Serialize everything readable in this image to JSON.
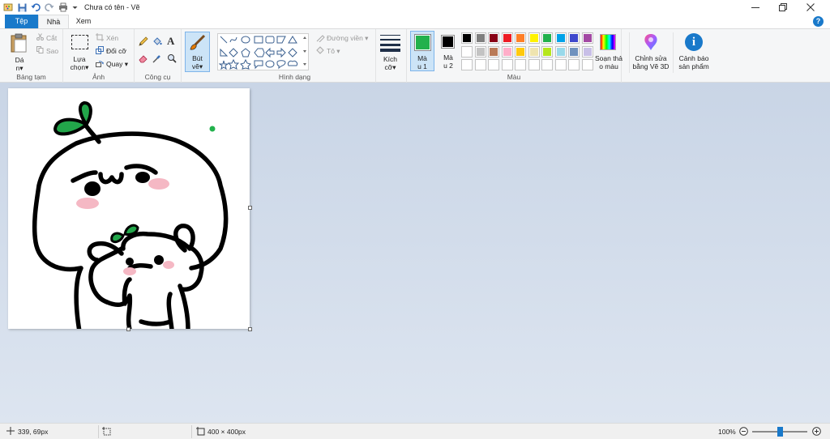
{
  "window": {
    "title": "Chưa có tên - Vẽ",
    "controls": [
      "minimize-icon",
      "restore-icon",
      "close-icon"
    ]
  },
  "tabs": {
    "file": "Tệp",
    "home": "Nhà",
    "view": "Xem",
    "help": "?"
  },
  "ribbon": {
    "clipboard": {
      "paste_label_1": "Dá",
      "paste_label_2": "n",
      "cut": "Cắt",
      "copy": "Sao",
      "group": "Bảng tạm"
    },
    "image": {
      "select_label_1": "Lựa",
      "select_label_2": "chọn",
      "crop": "Xén",
      "resize": "Đổi cỡ",
      "rotate": "Quay",
      "group": "Ảnh"
    },
    "tools": {
      "group": "Công cụ",
      "text_glyph": "A"
    },
    "brushes": {
      "label_1": "Bút",
      "label_2": "vẽ"
    },
    "shapes": {
      "outline": "Đường viền",
      "fill": "Tô",
      "group": "Hình dạng"
    },
    "size": {
      "label_1": "Kích",
      "label_2": "cỡ"
    },
    "colors": {
      "color1_label_1": "Mà",
      "color1_label_2": "u 1",
      "color2_label_1": "Mà",
      "color2_label_2": "u 2",
      "color1_value": "#22b14c",
      "color2_value": "#000000",
      "edit_colors_1": "Soạn thả",
      "edit_colors_2": "o màu",
      "group": "Màu",
      "palette_row1": [
        "#000000",
        "#7f7f7f",
        "#880015",
        "#ed1c24",
        "#ff7f27",
        "#fff200",
        "#22b14c",
        "#00a2e8",
        "#3f48cc",
        "#a349a4"
      ],
      "palette_row2": [
        "#ffffff",
        "#c3c3c3",
        "#b97a57",
        "#ffaec9",
        "#ffc90e",
        "#efe4b0",
        "#b5e61d",
        "#99d9ea",
        "#7092be",
        "#c8bfe7"
      ]
    },
    "paint3d": {
      "label_1": "Chỉnh sửa",
      "label_2": "bằng Vẽ 3D"
    },
    "alert": {
      "label_1": "Cảnh báo",
      "label_2": "sản phẩm"
    }
  },
  "status": {
    "cursor_pos": "339, 69px",
    "canvas_size": "400 × 400px",
    "zoom": "100%",
    "zoom_level": 1.0
  }
}
